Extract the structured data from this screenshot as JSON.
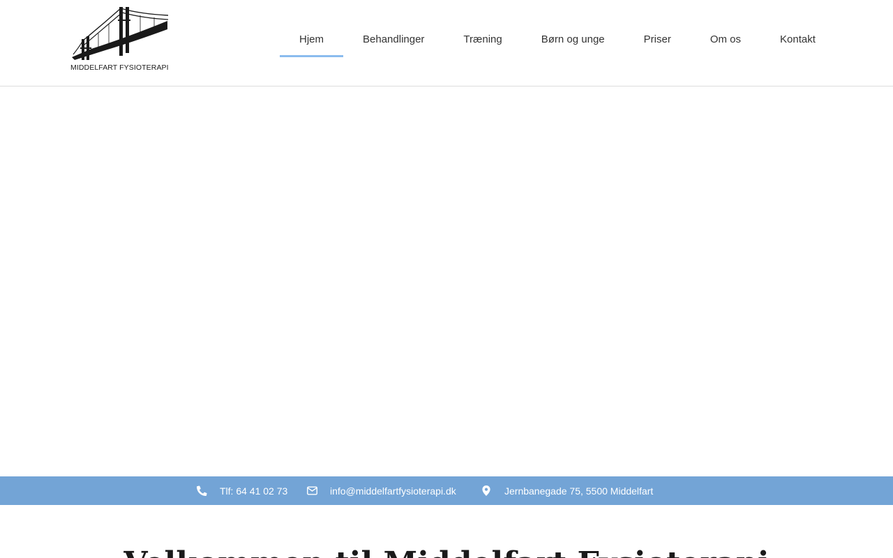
{
  "brand": {
    "logo_text": "MIDDELFART FYSIOTERAPI",
    "logo_icon": "bridge-logo-icon"
  },
  "nav": {
    "items": [
      {
        "label": "Hjem",
        "active": true
      },
      {
        "label": "Behandlinger",
        "active": false
      },
      {
        "label": "Træning",
        "active": false
      },
      {
        "label": "Børn og unge",
        "active": false
      },
      {
        "label": "Priser",
        "active": false
      },
      {
        "label": "Om os",
        "active": false
      },
      {
        "label": "Kontakt",
        "active": false
      }
    ],
    "active_color": "#8bbcee"
  },
  "contact_bar": {
    "background": "#73a4d6",
    "phone": {
      "icon": "phone-icon",
      "text": "Tlf: 64 41 02 73"
    },
    "email": {
      "icon": "envelope-icon",
      "text": "info@middelfartfysioterapi.dk"
    },
    "address": {
      "icon": "map-marker-icon",
      "text": "Jernbanegade 75, 5500 Middelfart"
    }
  },
  "welcome": {
    "heading": "Velkommen til Middelfart Fysioterapi"
  }
}
